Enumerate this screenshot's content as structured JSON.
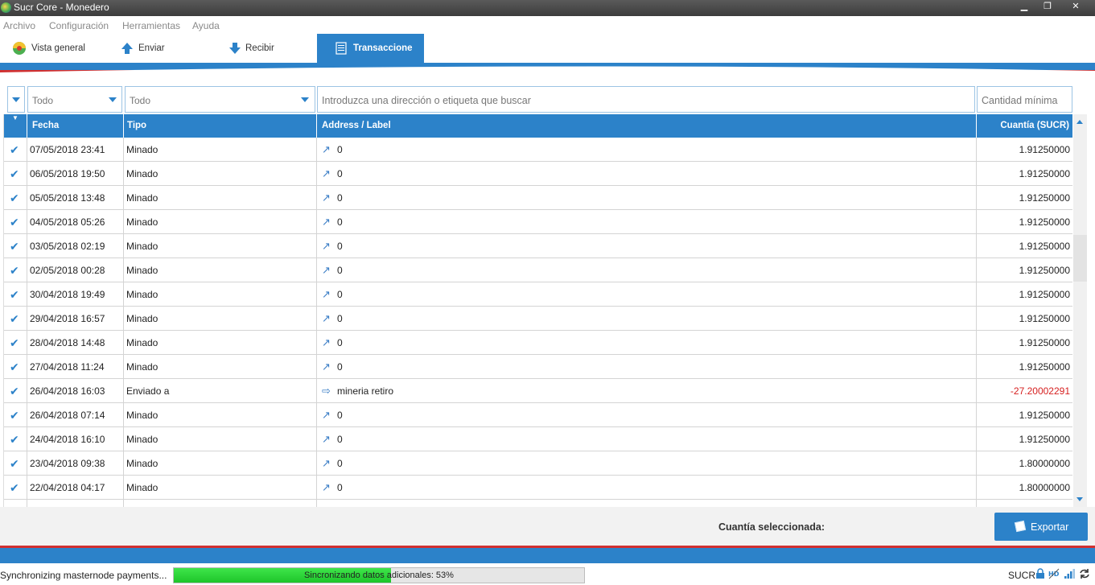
{
  "window": {
    "title": "Sucr Core - Monedero",
    "min": "▁",
    "max": "❐",
    "close": "✕"
  },
  "menu": [
    "Archivo",
    "Configuración",
    "Herramientas",
    "Ayuda"
  ],
  "toolbar": {
    "overview": "Vista general",
    "send": "Enviar",
    "receive": "Recibir",
    "transactions": "Transaccione"
  },
  "filters": {
    "date": "Todo",
    "type": "Todo",
    "search_placeholder": "Introduzca una dirección o etiqueta que buscar",
    "min_amount_placeholder": "Cantidad mínima"
  },
  "table": {
    "headers": {
      "date": "Fecha",
      "type": "Tipo",
      "address": "Address / Label",
      "amount": "Cuantía (SUCR)"
    },
    "rows": [
      {
        "date": "07/05/2018 23:41",
        "type": "Minado",
        "icon": "mined-arrow-icon",
        "address": "0",
        "amount": "1.91250000",
        "negative": false
      },
      {
        "date": "06/05/2018 19:50",
        "type": "Minado",
        "icon": "mined-arrow-icon",
        "address": "0",
        "amount": "1.91250000",
        "negative": false
      },
      {
        "date": "05/05/2018 13:48",
        "type": "Minado",
        "icon": "mined-arrow-icon",
        "address": "0",
        "amount": "1.91250000",
        "negative": false
      },
      {
        "date": "04/05/2018 05:26",
        "type": "Minado",
        "icon": "mined-arrow-icon",
        "address": "0",
        "amount": "1.91250000",
        "negative": false
      },
      {
        "date": "03/05/2018 02:19",
        "type": "Minado",
        "icon": "mined-arrow-icon",
        "address": "0",
        "amount": "1.91250000",
        "negative": false
      },
      {
        "date": "02/05/2018 00:28",
        "type": "Minado",
        "icon": "mined-arrow-icon",
        "address": "0",
        "amount": "1.91250000",
        "negative": false
      },
      {
        "date": "30/04/2018 19:49",
        "type": "Minado",
        "icon": "mined-arrow-icon",
        "address": "0",
        "amount": "1.91250000",
        "negative": false
      },
      {
        "date": "29/04/2018 16:57",
        "type": "Minado",
        "icon": "mined-arrow-icon",
        "address": "0",
        "amount": "1.91250000",
        "negative": false
      },
      {
        "date": "28/04/2018 14:48",
        "type": "Minado",
        "icon": "mined-arrow-icon",
        "address": "0",
        "amount": "1.91250000",
        "negative": false
      },
      {
        "date": "27/04/2018 11:24",
        "type": "Minado",
        "icon": "mined-arrow-icon",
        "address": "0",
        "amount": "1.91250000",
        "negative": false
      },
      {
        "date": "26/04/2018 16:03",
        "type": "Enviado a",
        "icon": "sent-arrow-icon",
        "address": "mineria retiro",
        "amount": "-27.20002291",
        "negative": true
      },
      {
        "date": "26/04/2018 07:14",
        "type": "Minado",
        "icon": "mined-arrow-icon",
        "address": "0",
        "amount": "1.91250000",
        "negative": false
      },
      {
        "date": "24/04/2018 16:10",
        "type": "Minado",
        "icon": "mined-arrow-icon",
        "address": "0",
        "amount": "1.91250000",
        "negative": false
      },
      {
        "date": "23/04/2018 09:38",
        "type": "Minado",
        "icon": "mined-arrow-icon",
        "address": "0",
        "amount": "1.80000000",
        "negative": false
      },
      {
        "date": "22/04/2018 04:17",
        "type": "Minado",
        "icon": "mined-arrow-icon",
        "address": "0",
        "amount": "1.80000000",
        "negative": false
      },
      {
        "date": "",
        "type": "",
        "icon": "mined-arrow-icon",
        "address": "",
        "amount": "",
        "negative": false
      }
    ]
  },
  "footer": {
    "selected_label": "Cuantía seleccionada:",
    "export_label": "Exportar"
  },
  "status": {
    "text": "Synchronizing masternode payments...",
    "progress_label": "Sincronizando datos adicionales: 53%",
    "progress": 0.53,
    "unit": "SUCR",
    "icons": [
      "lock-icon",
      "hd-icon",
      "signal-icon",
      "sync-icon"
    ]
  },
  "colors": {
    "accent": "#2c82c9",
    "danger": "#d13030",
    "progress": "#2ed83a",
    "negative": "#d62020"
  }
}
